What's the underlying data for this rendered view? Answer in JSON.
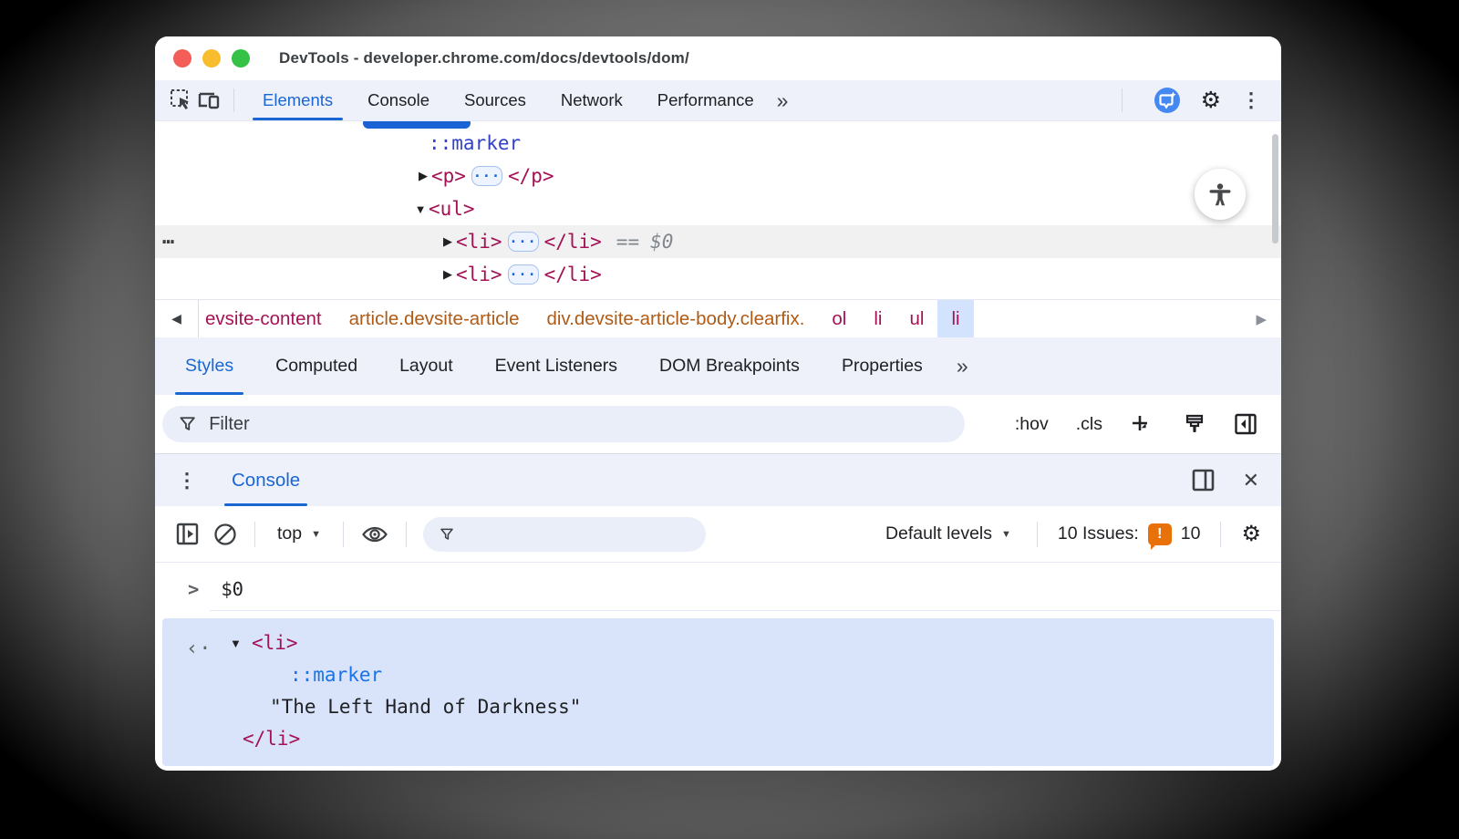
{
  "window": {
    "title": "DevTools - developer.chrome.com/docs/devtools/dom/"
  },
  "colors": {
    "accent": "#1a66d2",
    "tag": "#a31255",
    "pseudo_element": "#3042c8",
    "pseudo_console": "#1a73e8",
    "class_crumb": "#af5b15",
    "issues_badge": "#e8710a",
    "result_bg": "#d9e4fb",
    "selected_crumb_bg": "#d3e3fd",
    "toolbar_bg": "#eef1fa"
  },
  "icons": {
    "overflow_chevrons": "»",
    "kebab": "⋮",
    "gear": "⚙",
    "close": "✕",
    "crumb_left": "◀",
    "crumb_right": "▶",
    "tree_collapsed": "▶",
    "tree_expanded": "▼",
    "dropdown_caret": "▼",
    "gutter_dots": "⋯",
    "ellipsis_dots": "···",
    "returned_value": "‹·"
  },
  "main_tabs": {
    "items": [
      {
        "label": "Elements"
      },
      {
        "label": "Console"
      },
      {
        "label": "Sources"
      },
      {
        "label": "Network"
      },
      {
        "label": "Performance"
      }
    ]
  },
  "dom_tree": {
    "pseudo_marker": "::marker",
    "p_open": "<p>",
    "p_close": "</p>",
    "ul_open": "<ul>",
    "li_open": "<li>",
    "li_close": "</li>",
    "equals": "==",
    "dollar_zero": "$0"
  },
  "breadcrumbs": {
    "items": [
      {
        "label": "evsite-content"
      },
      {
        "label": "article.devsite-article"
      },
      {
        "label": "div.devsite-article-body.clearfix."
      },
      {
        "label": "ol"
      },
      {
        "label": "li"
      },
      {
        "label": "ul"
      },
      {
        "label": "li"
      }
    ]
  },
  "styles_tabs": {
    "items": [
      {
        "label": "Styles"
      },
      {
        "label": "Computed"
      },
      {
        "label": "Layout"
      },
      {
        "label": "Event Listeners"
      },
      {
        "label": "DOM Breakpoints"
      },
      {
        "label": "Properties"
      }
    ]
  },
  "styles_toolbar": {
    "filter_placeholder": "Filter",
    "pseudo_toggle": ":hov",
    "class_toggle": ".cls"
  },
  "drawer": {
    "console_tab": "Console"
  },
  "console_toolbar": {
    "context_selector": "top",
    "levels_selector": "Default levels",
    "issues_text": "10 Issues:",
    "issues_badge": "!",
    "issues_count": "10"
  },
  "console": {
    "prompt": ">",
    "command": "$0",
    "result": {
      "li_open": "<li>",
      "pseudo": "::marker",
      "string": "\"The Left Hand of Darkness\"",
      "li_close": "</li>"
    }
  }
}
